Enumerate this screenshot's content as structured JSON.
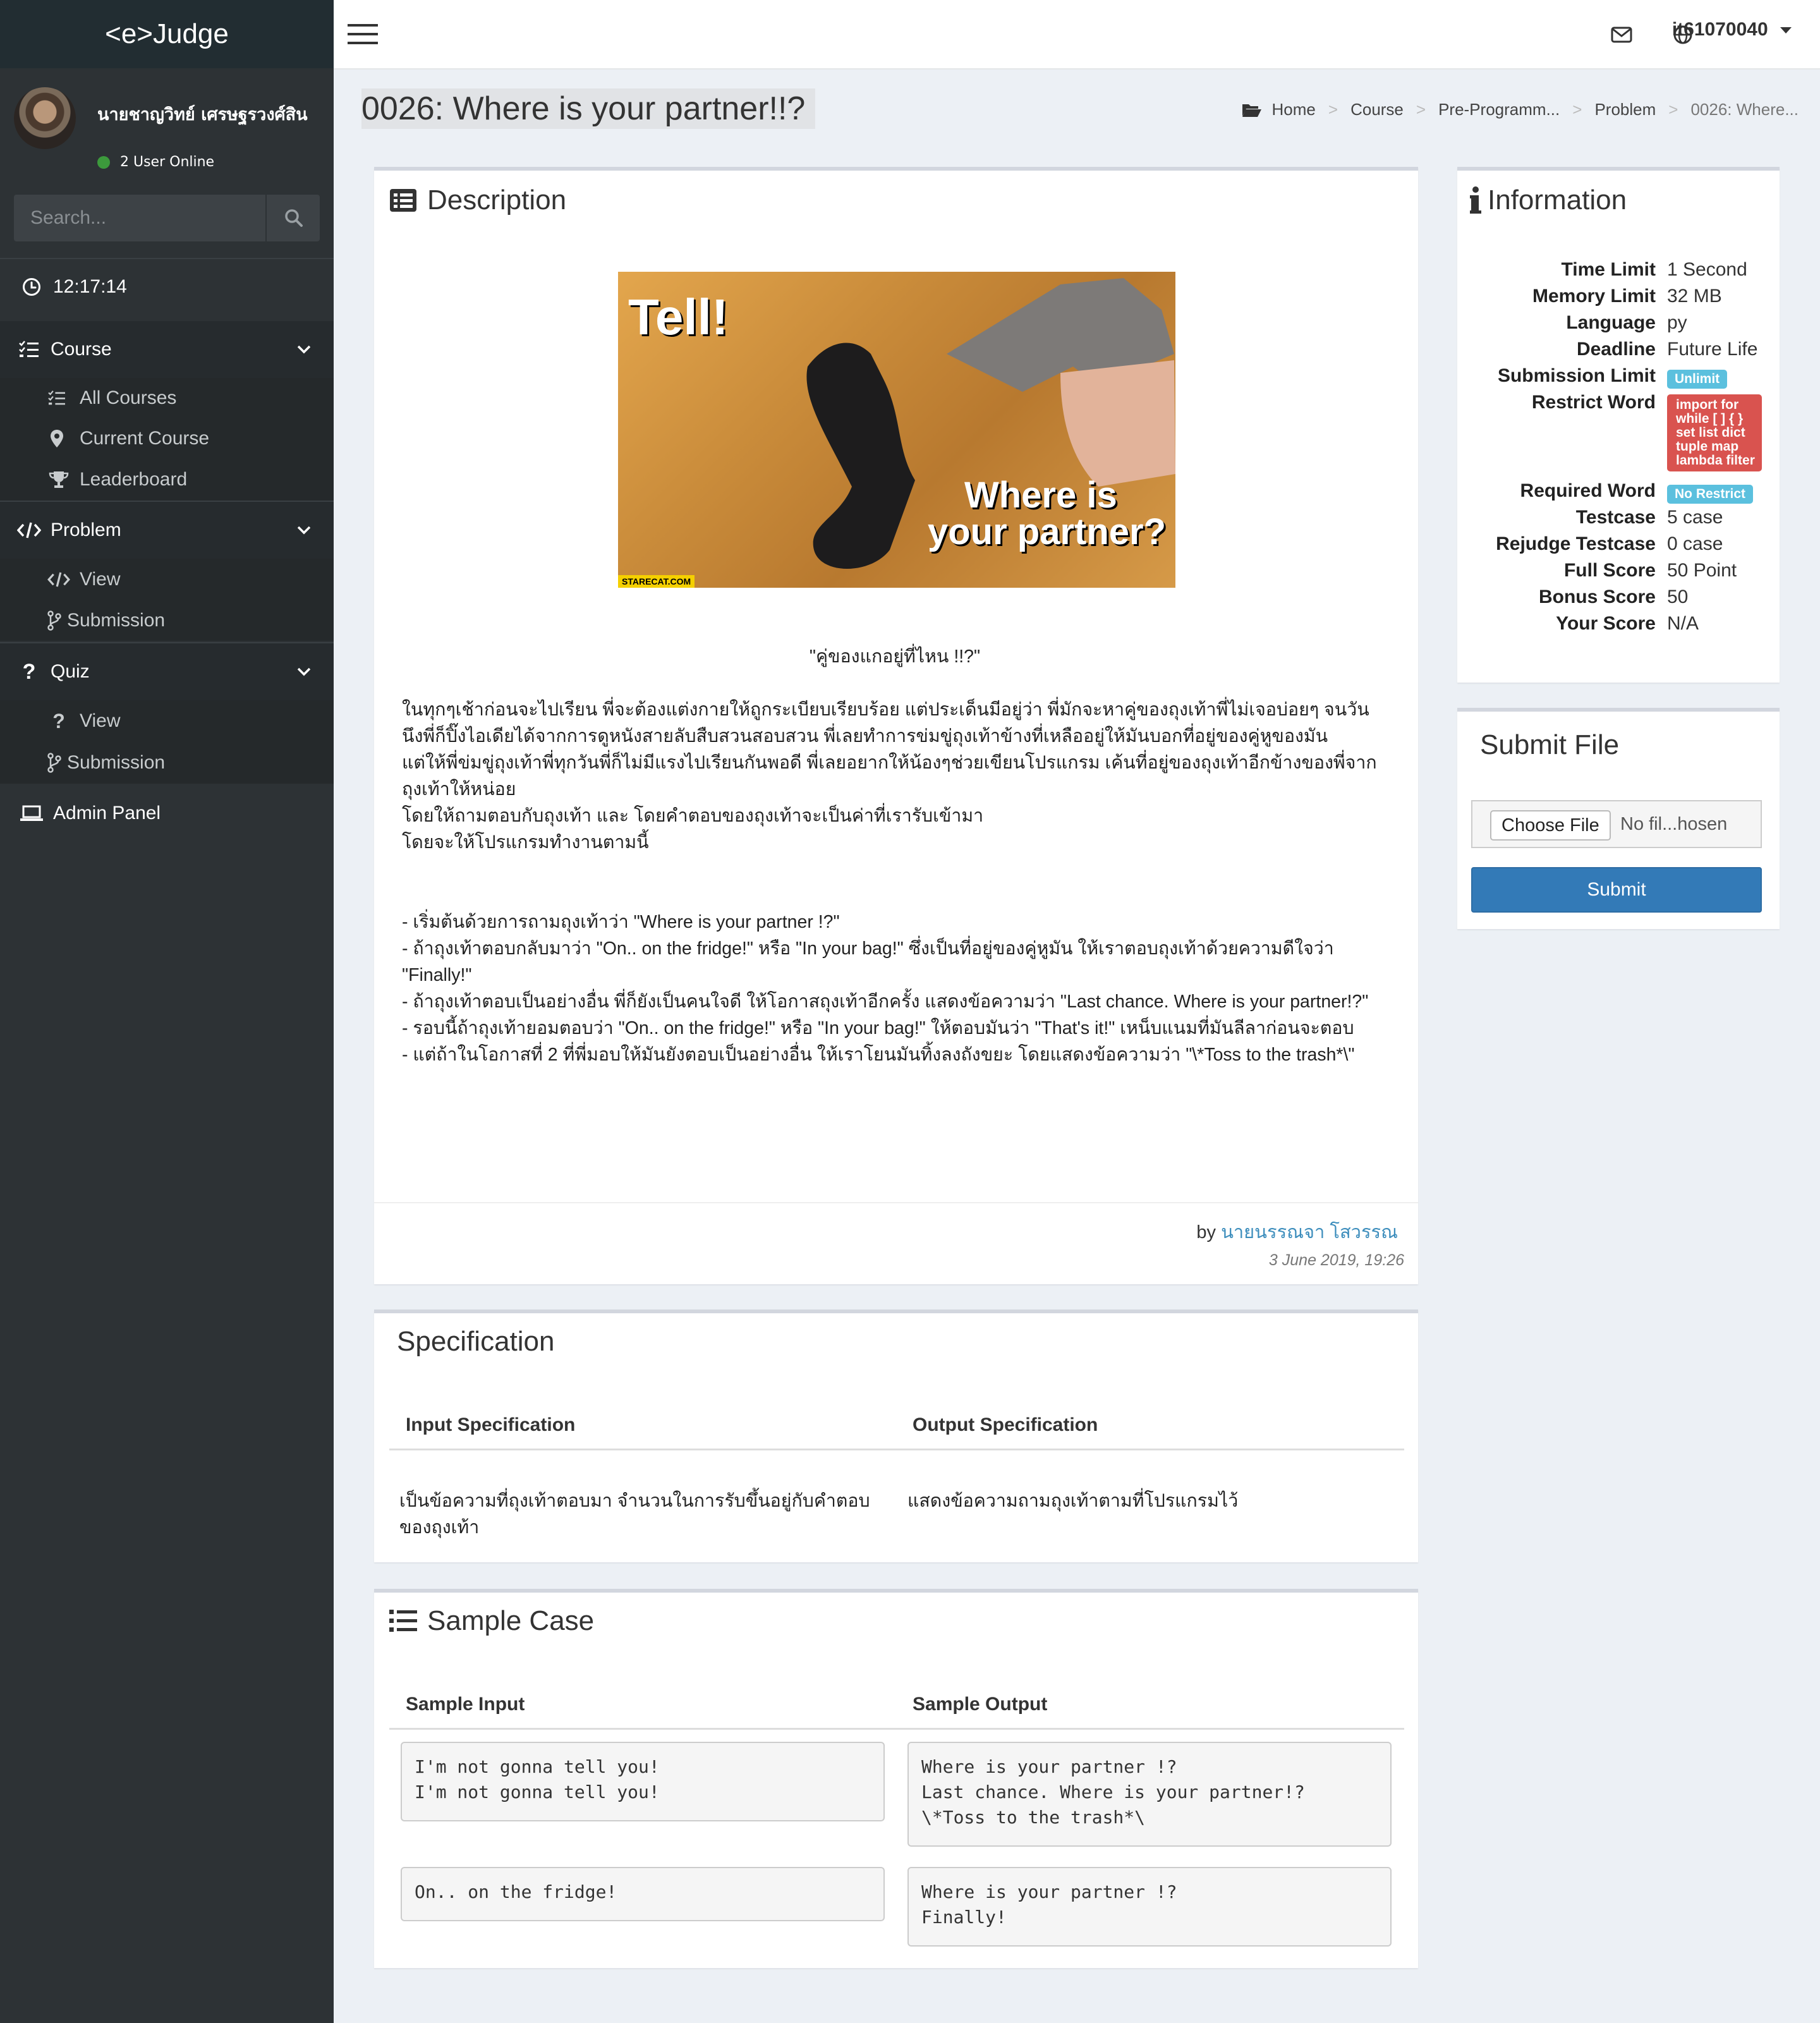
{
  "app": {
    "logo": "<e>Judge"
  },
  "user": {
    "name": "นายชาญวิทย์ เศรษฐรวงศ์สิน",
    "online": "2 User Online"
  },
  "search": {
    "placeholder": "Search..."
  },
  "clock": "12:17:14",
  "sidebar": {
    "course": {
      "label": "Course",
      "items": [
        "All Courses",
        "Current Course",
        "Leaderboard"
      ]
    },
    "problem": {
      "label": "Problem",
      "items": [
        "View",
        "Submission"
      ]
    },
    "quiz": {
      "label": "Quiz",
      "items": [
        "View",
        "Submission"
      ]
    },
    "admin": "Admin Panel"
  },
  "topbar": {
    "username": "it61070040"
  },
  "page": {
    "title": "0026: Where is your partner!!?",
    "breadcrumb": [
      "Home",
      "Course",
      "Pre-Programm...",
      "Problem",
      "0026: Where..."
    ]
  },
  "description": {
    "heading": "Description",
    "image_text": {
      "top": "Tell!",
      "bottom1": "Where is",
      "bottom2": "your partner?",
      "credit": "STARECAT.COM"
    },
    "quote": "\"คู่ของแกอยู่ที่ไหน !!?\"",
    "body": "    ในทุกๆเช้าก่อนจะไปเรียน พี่จะต้องแต่งกายให้ถูกระเบียบเรียบร้อย แต่ประเด็นมีอยู่ว่า พี่มักจะหาคู่ของถุงเท้าพี่ไม่เจอบ่อยๆ จนวันนึงพี่ก็ปิ๊งไอเดียได้จากการดูหนังสายลับสืบสวนสอบสวน พี่เลยทำการข่มขู่ถุงเท้าข้างที่เหลืออยู่ให้มันบอกที่อยู่ของคู่หูของมัน\n    แต่ให้พี่ข่มขู่ถุงเท้าพี่ทุกวันพี่ก็ไม่มีแรงไปเรียนกันพอดี พี่เลยอยากให้น้องๆช่วยเขียนโปรแกรม เค้นที่อยู่ของถุงเท้าอีกข้างของพี่จากถุงเท้าให้หน่อย\nโดยให้ถามตอบกับถุงเท้า และ โดยคำตอบของถุงเท้าจะเป็นค่าที่เรารับเข้ามา\nโดยจะให้โปรแกรมทำงานตามนี้\n\n\n- เริ่มต้นด้วยการถามถุงเท้าว่า \"Where is your partner !?\"\n- ถ้าถุงเท้าตอบกลับมาว่า \"On.. on the fridge!\" หรือ \"In your bag!\" ซึ่งเป็นที่อยู่ของคู่หูมัน ให้เราตอบถุงเท้าด้วยความดีใจว่า \"Finally!\"\n- ถ้าถุงเท้าตอบเป็นอย่างอื่น พี่ก็ยังเป็นคนใจดี ให้โอกาสถุงเท้าอีกครั้ง แสดงข้อความว่า \"Last chance. Where is your partner!?\"\n- รอบนี้ถ้าถุงเท้ายอมตอบว่า  \"On.. on the fridge!\" หรือ \"In your bag!\" ให้ตอบมันว่า \"That's it!\" เหน็บแนมที่มันลีลาก่อนจะตอบ\n- แต่ถ้าในโอกาสที่ 2 ที่พี่มอบให้มันยังตอบเป็นอย่างอื่น ให้เราโยนมันทิ้งลงถังขยะ โดยแสดงข้อความว่า \"\\*Toss to the trash*\\\"",
    "by_prefix": "by",
    "author": "นายนรรณจา โสวรรณ",
    "date": "3 June 2019, 19:26"
  },
  "specification": {
    "heading": "Specification",
    "input_header": "Input Specification",
    "output_header": "Output Specification",
    "input": "เป็นข้อความที่ถุงเท้าตอบมา จำนวนในการรับขึ้นอยู่กับคำตอบของถุงเท้า",
    "output": "แสดงข้อความถามถุงเท้าตามที่โปรแกรมไว้"
  },
  "sample": {
    "heading": "Sample Case",
    "input_header": "Sample Input",
    "output_header": "Sample Output",
    "cases": [
      {
        "input": "I'm not gonna tell you!\nI'm not gonna tell you!",
        "output": "Where is your partner !?\nLast chance. Where is your partner!?\n\\*Toss to the trash*\\"
      },
      {
        "input": "On.. on the fridge!",
        "output": "Where is your partner !?\nFinally!"
      }
    ]
  },
  "information": {
    "heading": "Information",
    "rows": [
      {
        "key": "Time Limit",
        "value": "1 Second"
      },
      {
        "key": "Memory Limit",
        "value": "32 MB"
      },
      {
        "key": "Language",
        "value": "py"
      },
      {
        "key": "Deadline",
        "value": "Future Life"
      },
      {
        "key": "Submission Limit",
        "value": "Unlimit"
      },
      {
        "key": "Restrict Word",
        "value": "import for while [ ] { } set list dict tuple map lambda filter"
      },
      {
        "key": "Required Word",
        "value": "No Restrict"
      },
      {
        "key": "Testcase",
        "value": "5 case"
      },
      {
        "key": "Rejudge Testcase",
        "value": "0 case"
      },
      {
        "key": "Full Score",
        "value": "50 Point"
      },
      {
        "key": "Bonus Score",
        "value": "50"
      },
      {
        "key": "Your Score",
        "value": "N/A"
      }
    ]
  },
  "submit": {
    "heading": "Submit File",
    "choose_label": "Choose File",
    "file_status": "No fil...hosen",
    "submit_label": "Submit"
  },
  "colors": {
    "sidebar": "#2d3235",
    "sidebar_sub": "#25292b",
    "logo_bar": "#222d32",
    "content_bg": "#ecf0f5",
    "primary": "#337ab7",
    "link": "#3c8dbc",
    "badge_info": "#5bc0de",
    "badge_danger": "#d9534f"
  }
}
